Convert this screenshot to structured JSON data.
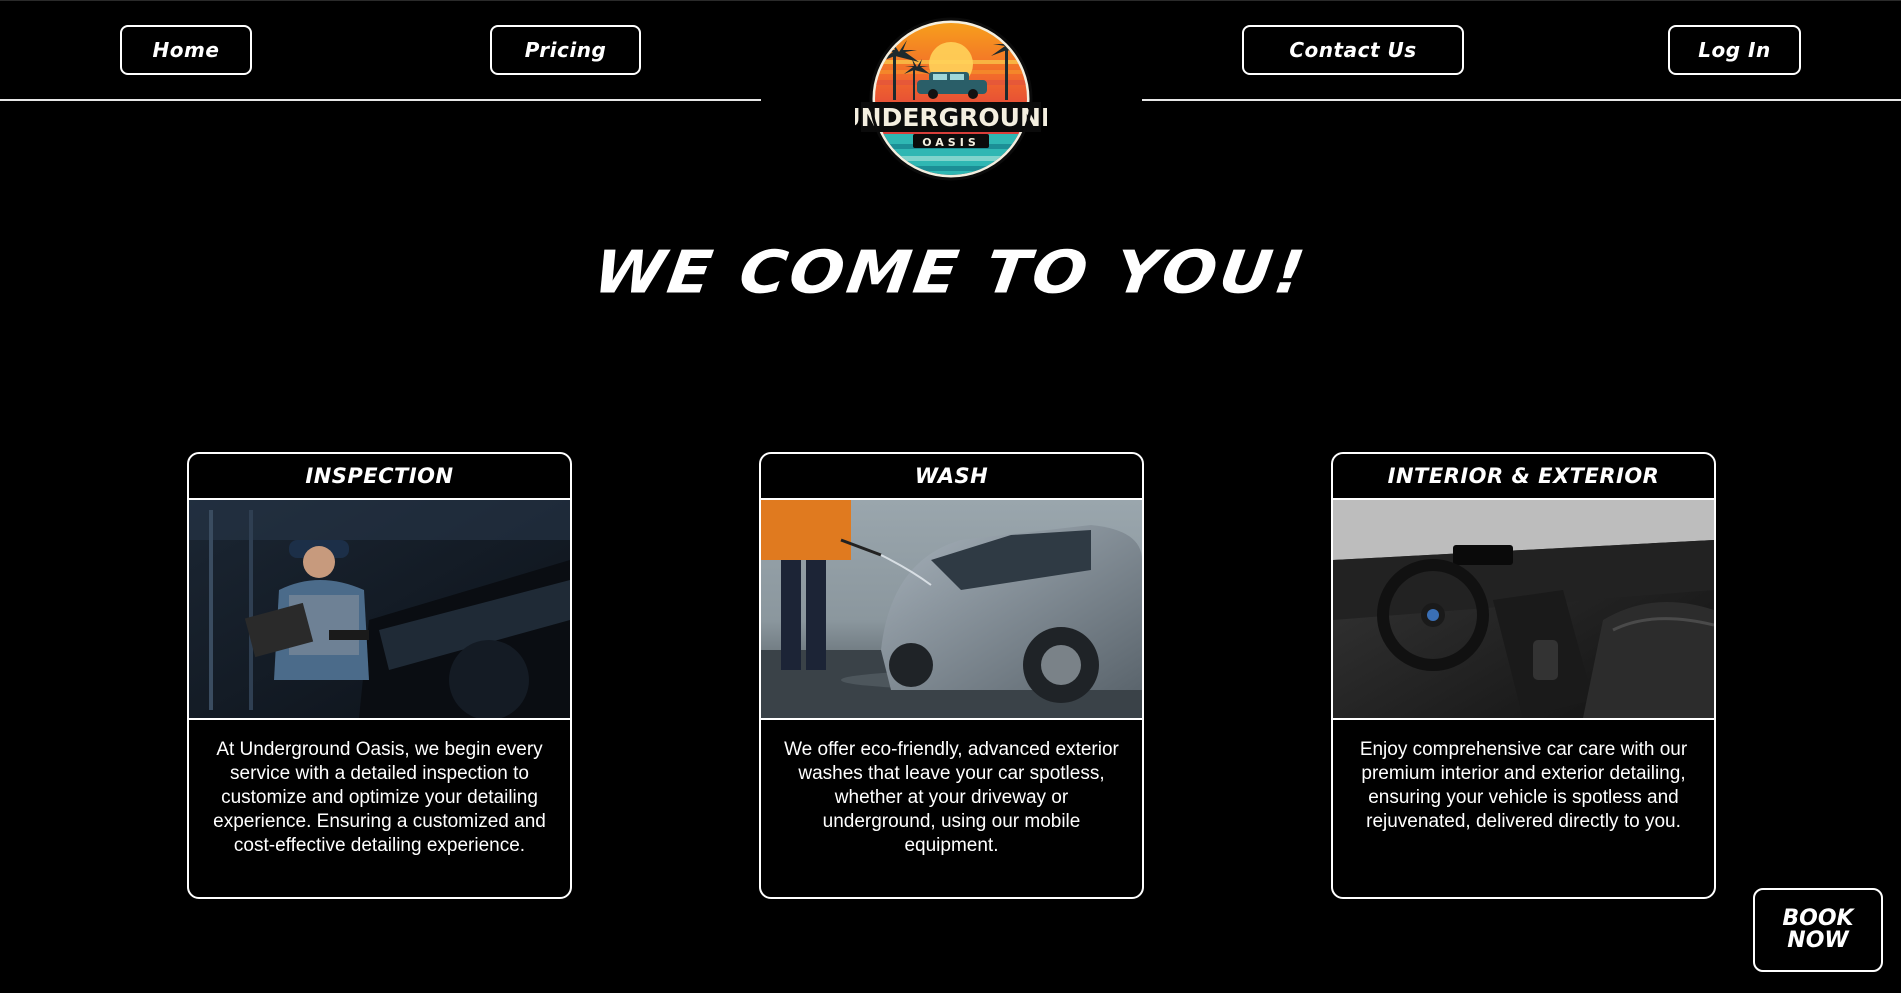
{
  "nav": {
    "home": "Home",
    "pricing": "Pricing",
    "contact": "Contact Us",
    "login": "Log In"
  },
  "logo": {
    "line1": "UNDERGROUND",
    "line2": "OASIS"
  },
  "hero": {
    "title": "WE COME TO YOU!"
  },
  "cards": [
    {
      "title": "INSPECTION",
      "description": "At Underground Oasis, we begin every service with a detailed inspection to customize and optimize your detailing experience. Ensuring a customized and cost-effective detailing experience."
    },
    {
      "title": "WASH",
      "description": "We offer eco-friendly, advanced exterior washes that leave your car spotless, whether at your driveway or underground, using our mobile equipment."
    },
    {
      "title": "INTERIOR & EXTERIOR",
      "description": "Enjoy comprehensive car care with our premium interior and exterior detailing, ensuring your vehicle is spotless and rejuvenated, delivered directly to you."
    }
  ],
  "book": {
    "line1": "BOOK",
    "line2": "NOW"
  }
}
